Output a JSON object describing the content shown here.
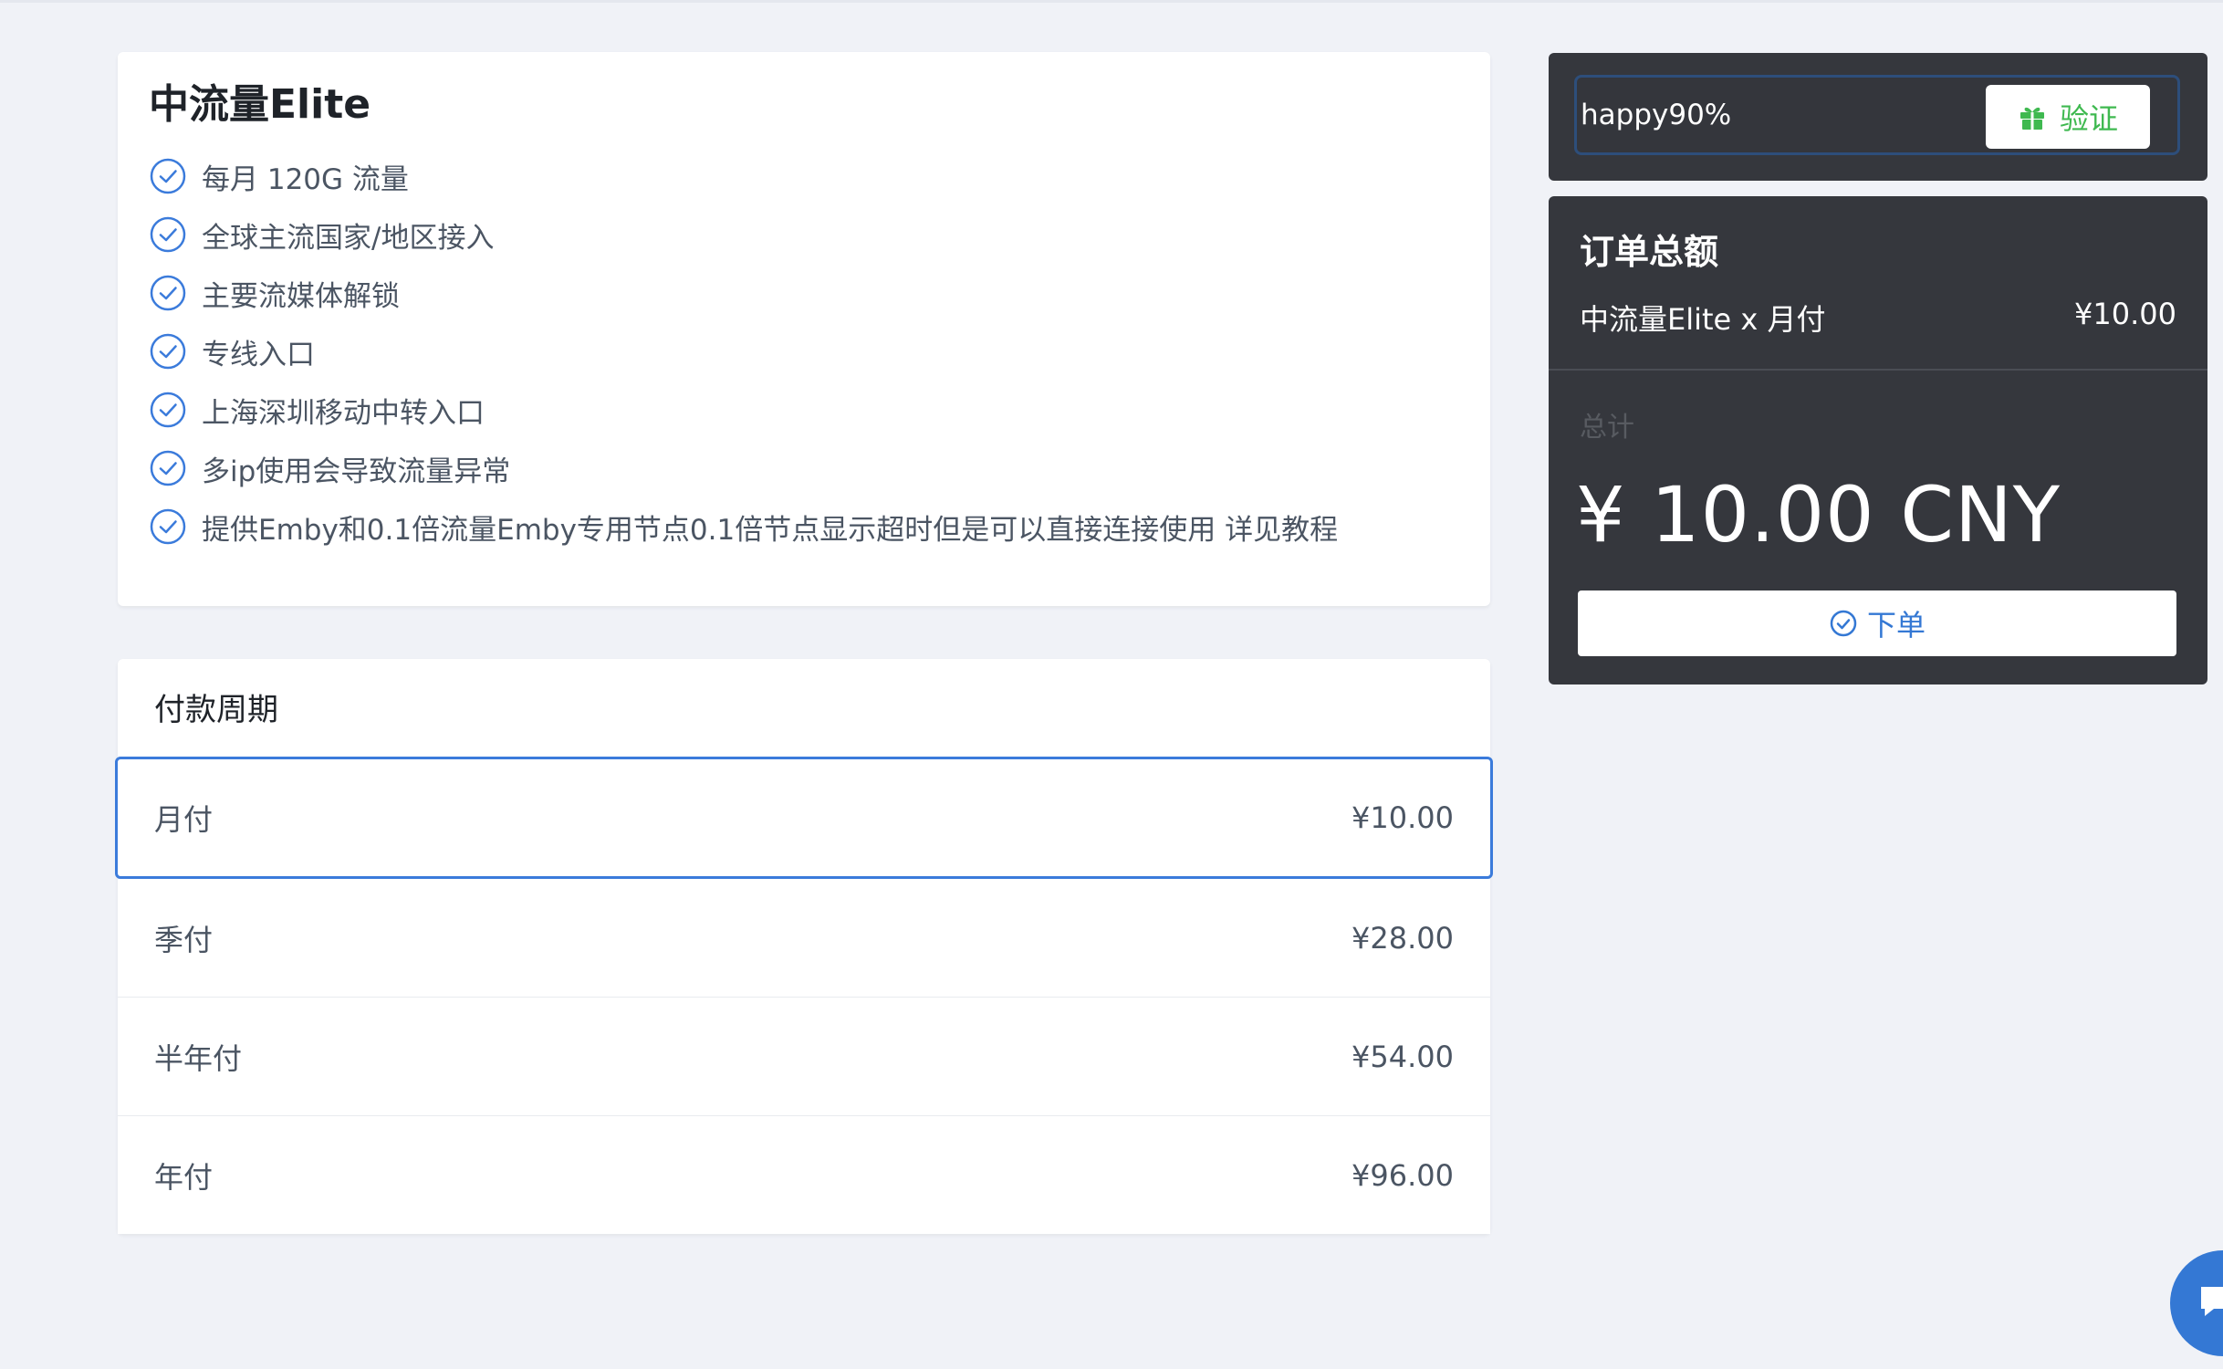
{
  "plan": {
    "title": "中流量Elite",
    "features": [
      "每月 120G 流量",
      "全球主流国家/地区接入",
      "主要流媒体解锁",
      "专线入口",
      "上海深圳移动中转入口",
      "多ip使用会导致流量异常",
      "提供Emby和0.1倍流量Emby专用节点0.1倍节点显示超时但是可以直接连接使用 详见教程"
    ]
  },
  "period": {
    "title": "付款周期",
    "selected_index": 0,
    "options": [
      {
        "name": "月付",
        "price": "¥10.00"
      },
      {
        "name": "季付",
        "price": "¥28.00"
      },
      {
        "name": "半年付",
        "price": "¥54.00"
      },
      {
        "name": "年付",
        "price": "¥96.00"
      }
    ]
  },
  "coupon": {
    "value": "happy90%",
    "verify_label": "验证"
  },
  "summary": {
    "title": "订单总额",
    "line_item": "中流量Elite x 月付",
    "line_price": "¥10.00",
    "total_label": "总计",
    "total_amount": "¥ 10.00 CNY",
    "order_label": "下单"
  },
  "colors": {
    "background": "#f0f2f7",
    "card_dark": "#35373d",
    "accent_blue": "#3478d4",
    "verify_green": "#3fb950"
  },
  "icons": {
    "feature_check": "check-circle-icon",
    "verify": "gift-icon",
    "order": "check-circle-icon",
    "chat": "chat-icon"
  }
}
